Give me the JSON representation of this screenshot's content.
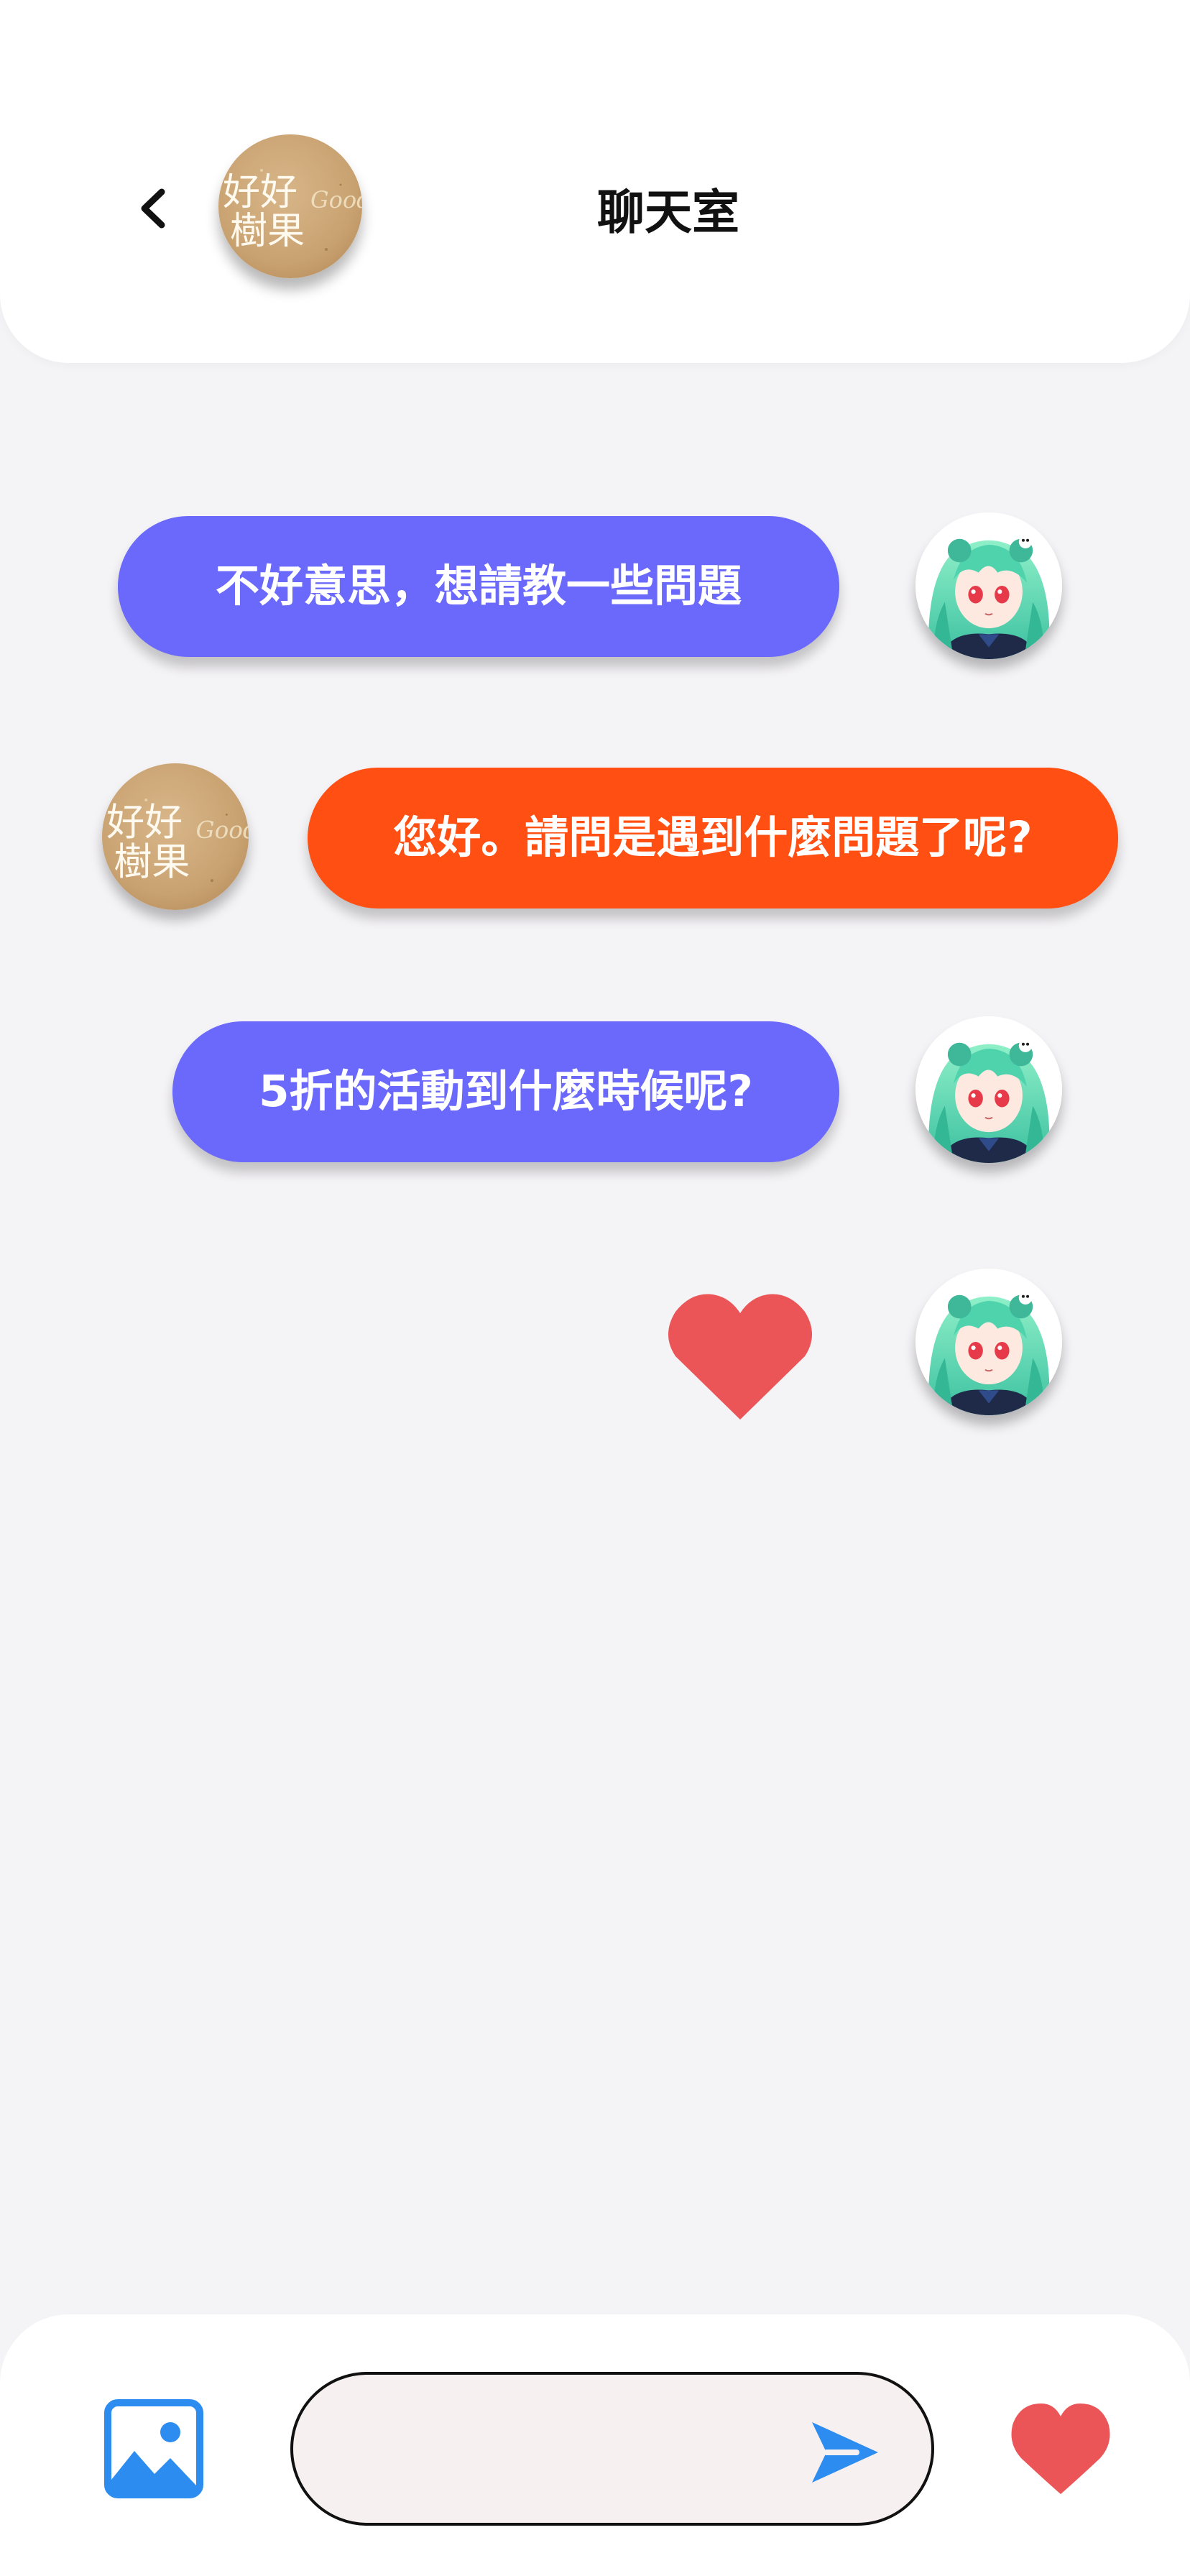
{
  "header": {
    "title": "聊天室",
    "back_icon": "chevron-left-icon",
    "logo_text": [
      "好好",
      "樹果"
    ],
    "logo_script": "Good"
  },
  "messages": [
    {
      "sender": "user",
      "text": "不好意思，想請教一些問題"
    },
    {
      "sender": "shop",
      "text": "您好。請問是遇到什麼問題了呢?"
    },
    {
      "sender": "user",
      "text": "5折的活動到什麼時候呢?"
    },
    {
      "sender": "user",
      "type": "sticker",
      "icon": "heart-icon"
    }
  ],
  "composer": {
    "image_icon": "image-icon",
    "input_value": "",
    "input_placeholder": "",
    "send_icon": "send-icon",
    "like_icon": "heart-icon"
  },
  "colors": {
    "background": "#f4f3f6",
    "user_bubble": "#6a69fb",
    "shop_bubble": "#ff4f12",
    "heart": "#ec5557",
    "accent_blue": "#2d8cf0"
  }
}
